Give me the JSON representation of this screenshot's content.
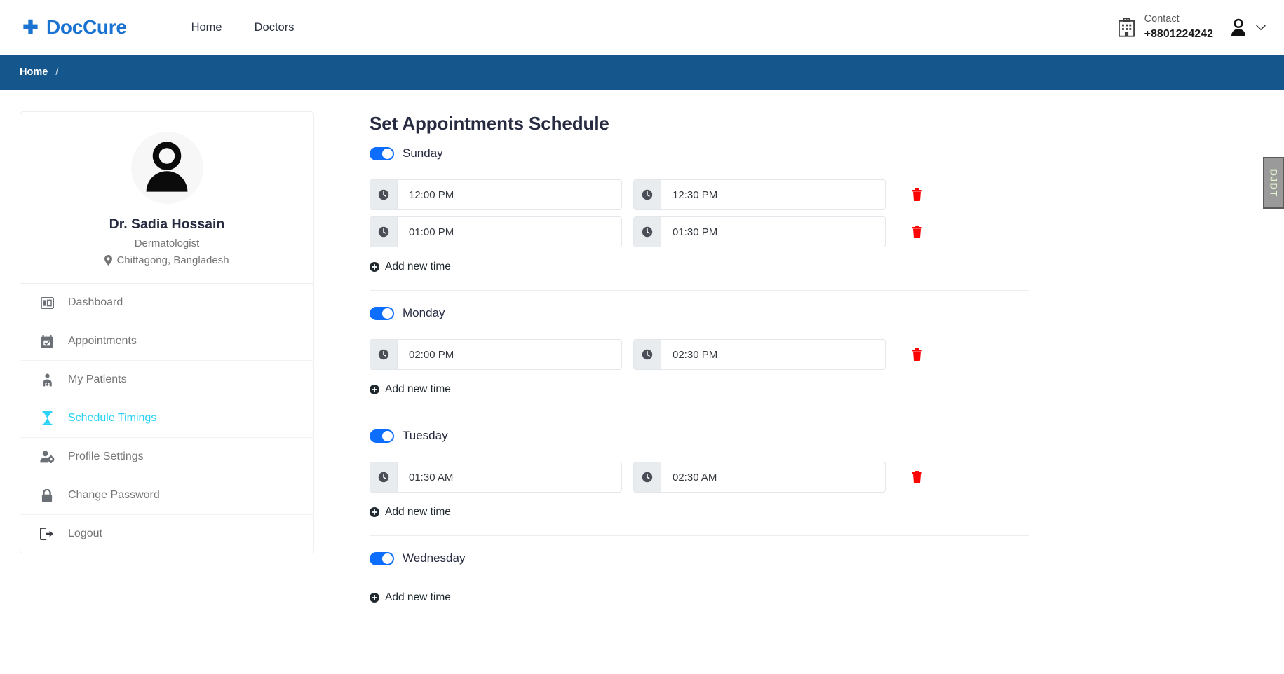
{
  "header": {
    "logo_text": "DocCure",
    "logo_icon": "medical-cross-icon",
    "nav": [
      {
        "label": "Home"
      },
      {
        "label": "Doctors"
      }
    ],
    "contact": {
      "icon": "hospital-icon",
      "label": "Contact",
      "number": "+8801224242"
    },
    "user_menu": {
      "avatar_icon": "user-avatar-icon",
      "chevron_icon": "chevron-down-icon"
    }
  },
  "breadcrumb": {
    "home_label": "Home",
    "separator": "/",
    "bg_color": "#15578d"
  },
  "sidebar": {
    "profile": {
      "avatar_icon": "user-avatar-icon",
      "name": "Dr. Sadia Hossain",
      "specialty": "Dermatologist",
      "location_icon": "map-pin-icon",
      "location": "Chittagong, Bangladesh"
    },
    "menu": [
      {
        "label": "Dashboard",
        "icon": "dashboard-icon",
        "active": false
      },
      {
        "label": "Appointments",
        "icon": "calendar-check-icon",
        "active": false
      },
      {
        "label": "My Patients",
        "icon": "patients-icon",
        "active": false
      },
      {
        "label": "Schedule Timings",
        "icon": "hourglass-icon",
        "active": true
      },
      {
        "label": "Profile Settings",
        "icon": "user-gear-icon",
        "active": false
      },
      {
        "label": "Change Password",
        "icon": "lock-icon",
        "active": false
      },
      {
        "label": "Logout",
        "icon": "logout-icon",
        "active": false
      }
    ],
    "active_color": "#2ad2f5"
  },
  "main": {
    "title": "Set Appointments Schedule",
    "add_time_label": "Add new time",
    "add_time_icon": "plus-circle-icon",
    "delete_icon": "trash-icon",
    "clock_icon": "clock-icon",
    "toggle_on_color": "#0d6efd",
    "days": [
      {
        "name": "Sunday",
        "enabled": true,
        "slots": [
          {
            "start": "12:00 PM",
            "end": "12:30 PM"
          },
          {
            "start": "01:00 PM",
            "end": "01:30 PM"
          }
        ]
      },
      {
        "name": "Monday",
        "enabled": true,
        "slots": [
          {
            "start": "02:00 PM",
            "end": "02:30 PM"
          }
        ]
      },
      {
        "name": "Tuesday",
        "enabled": true,
        "slots": [
          {
            "start": "01:30 AM",
            "end": "02:30 AM"
          }
        ]
      },
      {
        "name": "Wednesday",
        "enabled": true,
        "slots": []
      }
    ]
  },
  "debug_toolbar": {
    "label": "DJDT"
  }
}
